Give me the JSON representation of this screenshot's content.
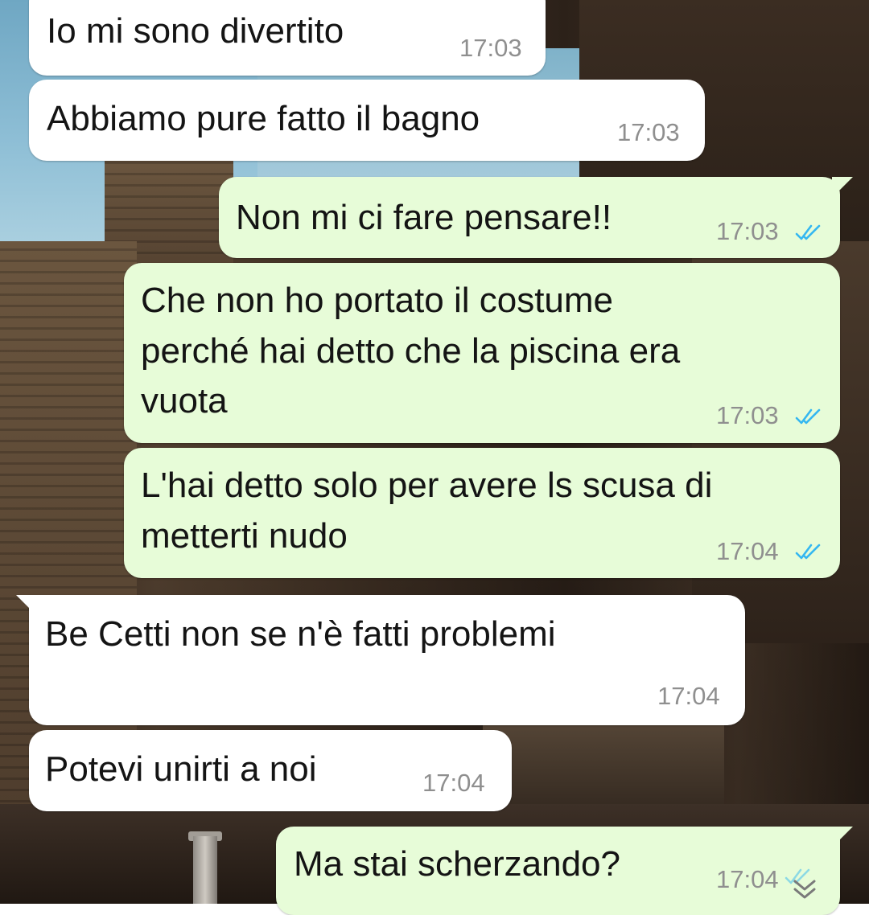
{
  "messages": [
    {
      "direction": "incoming",
      "text": "Io mi sono divertito",
      "time": "17:03"
    },
    {
      "direction": "incoming",
      "text": "Abbiamo pure fatto il bagno",
      "time": "17:03"
    },
    {
      "direction": "outgoing",
      "text": "Non mi ci fare pensare!!",
      "time": "17:03",
      "status": "read"
    },
    {
      "direction": "outgoing",
      "lines": [
        "Che non ho portato il costume",
        "perché hai detto che la piscina era",
        "vuota"
      ],
      "time": "17:03",
      "status": "read"
    },
    {
      "direction": "outgoing",
      "lines": [
        "L'hai detto solo per avere ls scusa di",
        "metterti nudo"
      ],
      "time": "17:04",
      "status": "read"
    },
    {
      "direction": "incoming",
      "text": "Be Cetti non se n'è fatti problemi",
      "time": "17:04"
    },
    {
      "direction": "incoming",
      "text": "Potevi unirti a noi",
      "time": "17:04"
    },
    {
      "direction": "outgoing",
      "text": "Ma stai scherzando?",
      "time": "17:04",
      "status": "read"
    }
  ],
  "colors": {
    "incoming_bubble": "#ffffff",
    "outgoing_bubble": "#e7fcd8",
    "read_ticks": "#34b7f1",
    "timestamp": "#8f8f8f"
  },
  "icons": {
    "read_receipt": "double-check-icon",
    "scroll_down": "chevron-double-down-icon"
  }
}
